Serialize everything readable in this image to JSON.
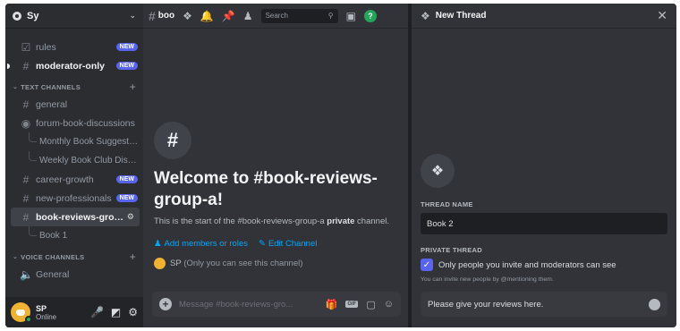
{
  "server": {
    "name": "Sy"
  },
  "sidebar": {
    "top_channels": [
      {
        "name": "rules",
        "badge": "NEW"
      },
      {
        "name": "moderator-only",
        "badge": "NEW"
      }
    ],
    "text_category": "TEXT CHANNELS",
    "text_channels": {
      "general": "general",
      "forum": "forum-book-discussions",
      "forum_threads": [
        "Monthly Book Suggestio...",
        "Weekly Book Club Discu..."
      ],
      "career": {
        "name": "career-growth",
        "badge": "NEW"
      },
      "newpro": {
        "name": "new-professionals",
        "badge": "NEW"
      },
      "active": "book-reviews-grou...",
      "active_threads": [
        "Book 1"
      ]
    },
    "voice_category": "VOICE CHANNELS",
    "voice_channels": [
      "General"
    ]
  },
  "user": {
    "name": "SP",
    "status": "Online"
  },
  "topbar": {
    "channel": "boo",
    "search_placeholder": "Search"
  },
  "welcome": {
    "title": "Welcome to #book-reviews-group-a!",
    "desc_prefix": "This is the start of the #book-reviews-group-a ",
    "desc_bold": "private",
    "desc_suffix": " channel.",
    "add_members": "Add members or roles",
    "edit_channel": "Edit Channel",
    "sys_name": "SP",
    "sys_note": "(Only you can see this channel)"
  },
  "composer": {
    "placeholder": "Message #book-reviews-gro...",
    "gif": "GIF"
  },
  "thread_panel": {
    "title": "New Thread",
    "name_label": "THREAD NAME",
    "name_value": "Book 2",
    "private_label": "PRIVATE THREAD",
    "private_option": "Only people you invite and moderators can see",
    "hint": "You can invite new people by @mentioning them.",
    "message_value": "Please give your reviews here."
  }
}
